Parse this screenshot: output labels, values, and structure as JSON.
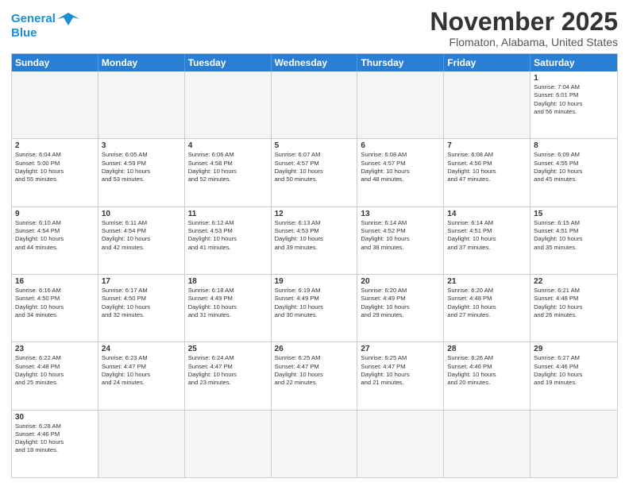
{
  "header": {
    "logo_line1": "General",
    "logo_line2": "Blue",
    "month": "November 2025",
    "location": "Flomaton, Alabama, United States"
  },
  "days_of_week": [
    "Sunday",
    "Monday",
    "Tuesday",
    "Wednesday",
    "Thursday",
    "Friday",
    "Saturday"
  ],
  "weeks": [
    [
      {
        "day": "",
        "info": ""
      },
      {
        "day": "",
        "info": ""
      },
      {
        "day": "",
        "info": ""
      },
      {
        "day": "",
        "info": ""
      },
      {
        "day": "",
        "info": ""
      },
      {
        "day": "",
        "info": ""
      },
      {
        "day": "1",
        "info": "Sunrise: 7:04 AM\nSunset: 6:01 PM\nDaylight: 10 hours\nand 56 minutes."
      }
    ],
    [
      {
        "day": "2",
        "info": "Sunrise: 6:04 AM\nSunset: 5:00 PM\nDaylight: 10 hours\nand 55 minutes."
      },
      {
        "day": "3",
        "info": "Sunrise: 6:05 AM\nSunset: 4:59 PM\nDaylight: 10 hours\nand 53 minutes."
      },
      {
        "day": "4",
        "info": "Sunrise: 6:06 AM\nSunset: 4:58 PM\nDaylight: 10 hours\nand 52 minutes."
      },
      {
        "day": "5",
        "info": "Sunrise: 6:07 AM\nSunset: 4:57 PM\nDaylight: 10 hours\nand 50 minutes."
      },
      {
        "day": "6",
        "info": "Sunrise: 6:08 AM\nSunset: 4:57 PM\nDaylight: 10 hours\nand 48 minutes."
      },
      {
        "day": "7",
        "info": "Sunrise: 6:08 AM\nSunset: 4:56 PM\nDaylight: 10 hours\nand 47 minutes."
      },
      {
        "day": "8",
        "info": "Sunrise: 6:09 AM\nSunset: 4:55 PM\nDaylight: 10 hours\nand 45 minutes."
      }
    ],
    [
      {
        "day": "9",
        "info": "Sunrise: 6:10 AM\nSunset: 4:54 PM\nDaylight: 10 hours\nand 44 minutes."
      },
      {
        "day": "10",
        "info": "Sunrise: 6:11 AM\nSunset: 4:54 PM\nDaylight: 10 hours\nand 42 minutes."
      },
      {
        "day": "11",
        "info": "Sunrise: 6:12 AM\nSunset: 4:53 PM\nDaylight: 10 hours\nand 41 minutes."
      },
      {
        "day": "12",
        "info": "Sunrise: 6:13 AM\nSunset: 4:53 PM\nDaylight: 10 hours\nand 39 minutes."
      },
      {
        "day": "13",
        "info": "Sunrise: 6:14 AM\nSunset: 4:52 PM\nDaylight: 10 hours\nand 38 minutes."
      },
      {
        "day": "14",
        "info": "Sunrise: 6:14 AM\nSunset: 4:51 PM\nDaylight: 10 hours\nand 37 minutes."
      },
      {
        "day": "15",
        "info": "Sunrise: 6:15 AM\nSunset: 4:51 PM\nDaylight: 10 hours\nand 35 minutes."
      }
    ],
    [
      {
        "day": "16",
        "info": "Sunrise: 6:16 AM\nSunset: 4:50 PM\nDaylight: 10 hours\nand 34 minutes."
      },
      {
        "day": "17",
        "info": "Sunrise: 6:17 AM\nSunset: 4:50 PM\nDaylight: 10 hours\nand 32 minutes."
      },
      {
        "day": "18",
        "info": "Sunrise: 6:18 AM\nSunset: 4:49 PM\nDaylight: 10 hours\nand 31 minutes."
      },
      {
        "day": "19",
        "info": "Sunrise: 6:19 AM\nSunset: 4:49 PM\nDaylight: 10 hours\nand 30 minutes."
      },
      {
        "day": "20",
        "info": "Sunrise: 6:20 AM\nSunset: 4:49 PM\nDaylight: 10 hours\nand 29 minutes."
      },
      {
        "day": "21",
        "info": "Sunrise: 6:20 AM\nSunset: 4:48 PM\nDaylight: 10 hours\nand 27 minutes."
      },
      {
        "day": "22",
        "info": "Sunrise: 6:21 AM\nSunset: 4:48 PM\nDaylight: 10 hours\nand 26 minutes."
      }
    ],
    [
      {
        "day": "23",
        "info": "Sunrise: 6:22 AM\nSunset: 4:48 PM\nDaylight: 10 hours\nand 25 minutes."
      },
      {
        "day": "24",
        "info": "Sunrise: 6:23 AM\nSunset: 4:47 PM\nDaylight: 10 hours\nand 24 minutes."
      },
      {
        "day": "25",
        "info": "Sunrise: 6:24 AM\nSunset: 4:47 PM\nDaylight: 10 hours\nand 23 minutes."
      },
      {
        "day": "26",
        "info": "Sunrise: 6:25 AM\nSunset: 4:47 PM\nDaylight: 10 hours\nand 22 minutes."
      },
      {
        "day": "27",
        "info": "Sunrise: 6:25 AM\nSunset: 4:47 PM\nDaylight: 10 hours\nand 21 minutes."
      },
      {
        "day": "28",
        "info": "Sunrise: 6:26 AM\nSunset: 4:46 PM\nDaylight: 10 hours\nand 20 minutes."
      },
      {
        "day": "29",
        "info": "Sunrise: 6:27 AM\nSunset: 4:46 PM\nDaylight: 10 hours\nand 19 minutes."
      }
    ],
    [
      {
        "day": "30",
        "info": "Sunrise: 6:28 AM\nSunset: 4:46 PM\nDaylight: 10 hours\nand 18 minutes."
      },
      {
        "day": "",
        "info": ""
      },
      {
        "day": "",
        "info": ""
      },
      {
        "day": "",
        "info": ""
      },
      {
        "day": "",
        "info": ""
      },
      {
        "day": "",
        "info": ""
      },
      {
        "day": "",
        "info": ""
      }
    ]
  ]
}
